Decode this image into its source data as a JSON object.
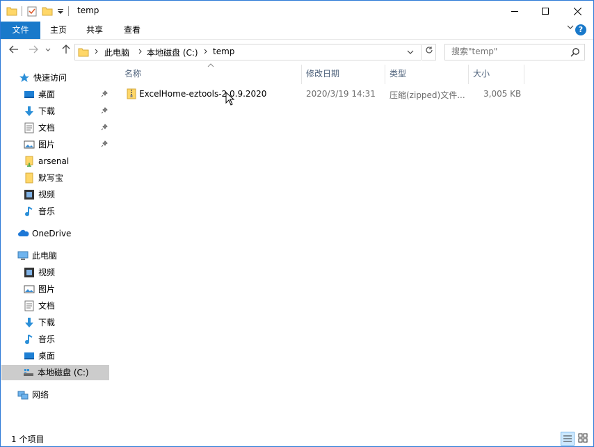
{
  "window": {
    "title": "temp",
    "controls": {
      "minimize": "—",
      "maximize": "☐",
      "close": "✕"
    }
  },
  "ribbon": {
    "tabs": [
      {
        "label": "文件"
      },
      {
        "label": "主页"
      },
      {
        "label": "共享"
      },
      {
        "label": "查看"
      }
    ],
    "help": "?"
  },
  "address": {
    "crumbs": [
      "此电脑",
      "本地磁盘 (C:)",
      "temp"
    ],
    "search_placeholder": "搜索\"temp\""
  },
  "sidebar": {
    "quick_access": {
      "label": "快速访问",
      "items": [
        {
          "label": "桌面",
          "icon": "desktop-icon",
          "pinned": true
        },
        {
          "label": "下载",
          "icon": "download-icon",
          "pinned": true
        },
        {
          "label": "文档",
          "icon": "document-icon",
          "pinned": true
        },
        {
          "label": "图片",
          "icon": "picture-icon",
          "pinned": true
        },
        {
          "label": "arsenal",
          "icon": "folder-icon",
          "pinned": false
        },
        {
          "label": "默写宝",
          "icon": "folder-icon",
          "pinned": false
        },
        {
          "label": "视频",
          "icon": "video-icon",
          "pinned": false
        },
        {
          "label": "音乐",
          "icon": "music-icon",
          "pinned": false
        }
      ]
    },
    "onedrive": {
      "label": "OneDrive"
    },
    "this_pc": {
      "label": "此电脑",
      "items": [
        {
          "label": "视频",
          "icon": "video-icon"
        },
        {
          "label": "图片",
          "icon": "picture-icon"
        },
        {
          "label": "文档",
          "icon": "document-icon"
        },
        {
          "label": "下载",
          "icon": "download-icon"
        },
        {
          "label": "音乐",
          "icon": "music-icon"
        },
        {
          "label": "桌面",
          "icon": "desktop-icon"
        },
        {
          "label": "本地磁盘 (C:)",
          "icon": "drive-icon",
          "selected": true
        }
      ]
    },
    "network": {
      "label": "网络"
    }
  },
  "columns": {
    "name": "名称",
    "date": "修改日期",
    "type": "类型",
    "size": "大小"
  },
  "files": [
    {
      "name": "ExcelHome-eztools-2.0.9.2020",
      "date": "2020/3/19 14:31",
      "type": "压缩(zipped)文件...",
      "size": "3,005 KB",
      "icon": "zip-folder-icon"
    }
  ],
  "status": {
    "count": "1 个项目"
  },
  "colors": {
    "accent": "#1979ca",
    "selected": "#cccccc",
    "border": "#2b79d7"
  }
}
